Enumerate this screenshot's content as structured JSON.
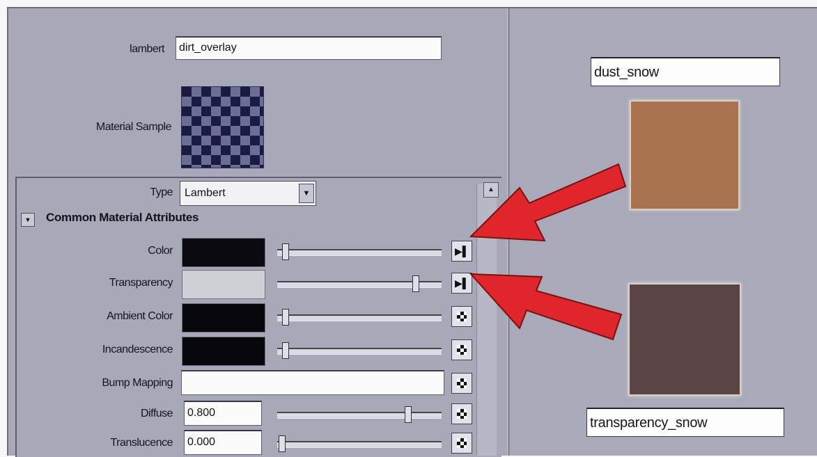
{
  "header": {
    "node_type_label": "lambert",
    "material_name": "dirt_overlay",
    "material_sample_label": "Material Sample"
  },
  "attributes": {
    "type_label": "Type",
    "type_value": "Lambert",
    "section_title": "Common Material Attributes",
    "rows": [
      {
        "label": "Color",
        "kind": "color",
        "swatch_color": "#0a0a10",
        "slider_level": 0.02,
        "button": "connected"
      },
      {
        "label": "Transparency",
        "kind": "color",
        "swatch_color": "#cfcfd6",
        "slider_level": 0.85,
        "button": "connected"
      },
      {
        "label": "Ambient Color",
        "kind": "color",
        "swatch_color": "#07070c",
        "slider_level": 0.02,
        "button": "map"
      },
      {
        "label": "Incandescence",
        "kind": "color",
        "swatch_color": "#07070c",
        "slider_level": 0.02,
        "button": "map"
      },
      {
        "label": "Bump Mapping",
        "kind": "field",
        "button": "map"
      },
      {
        "label": "Diffuse",
        "kind": "number",
        "value": "0.800",
        "slider_level": 0.8,
        "button": "map"
      },
      {
        "label": "Translucence",
        "kind": "number",
        "value": "0.000",
        "slider_level": 0.0,
        "button": "map"
      }
    ]
  },
  "textures": {
    "top": {
      "name": "dust_snow",
      "color": "#a8734e"
    },
    "bottom": {
      "name": "transparency_snow",
      "color": "#5b4446"
    }
  },
  "colors": {
    "arrow": "#e0262a"
  }
}
